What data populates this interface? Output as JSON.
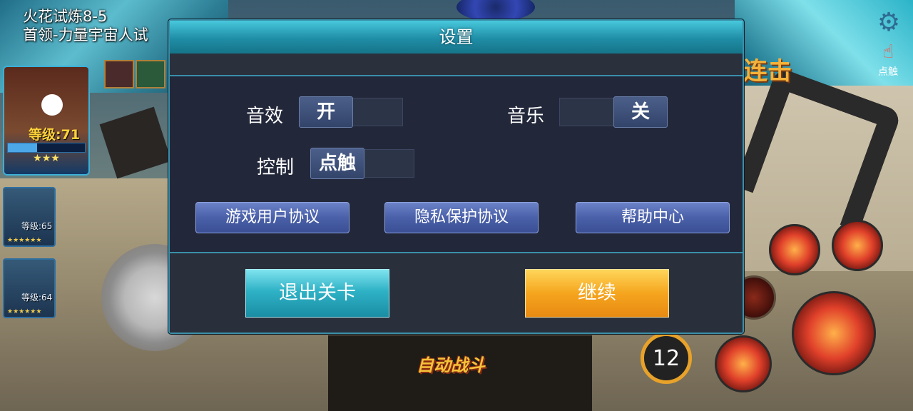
{
  "game": {
    "stage_line1": "火花试炼8-5",
    "stage_line2": "首领-力量宇宙人试",
    "hero_level": "等级:71",
    "hero_stars": "★★★",
    "hero_xp_fraction": 0.38,
    "ally1_level": "等级:65",
    "ally2_level": "等级:64",
    "ally_stars": "★★★★★★",
    "touch_label": "点触",
    "combo_text": "连击",
    "skill_count": "12",
    "auto_battle": "自动战斗"
  },
  "dialog": {
    "title": "设置",
    "sound_label": "音效",
    "sound_value": "开",
    "music_label": "音乐",
    "music_value": "关",
    "control_label": "控制",
    "control_value": "点触",
    "user_agreement": "游戏用户协议",
    "privacy": "隐私保护协议",
    "help_center": "帮助中心",
    "exit_level": "退出关卡",
    "continue": "继续"
  },
  "colors": {
    "dialog_bg": "#202536",
    "header_accent": "#2ab0c8",
    "exit_button": "#2fb2c6",
    "continue_button": "#f5a51e"
  }
}
